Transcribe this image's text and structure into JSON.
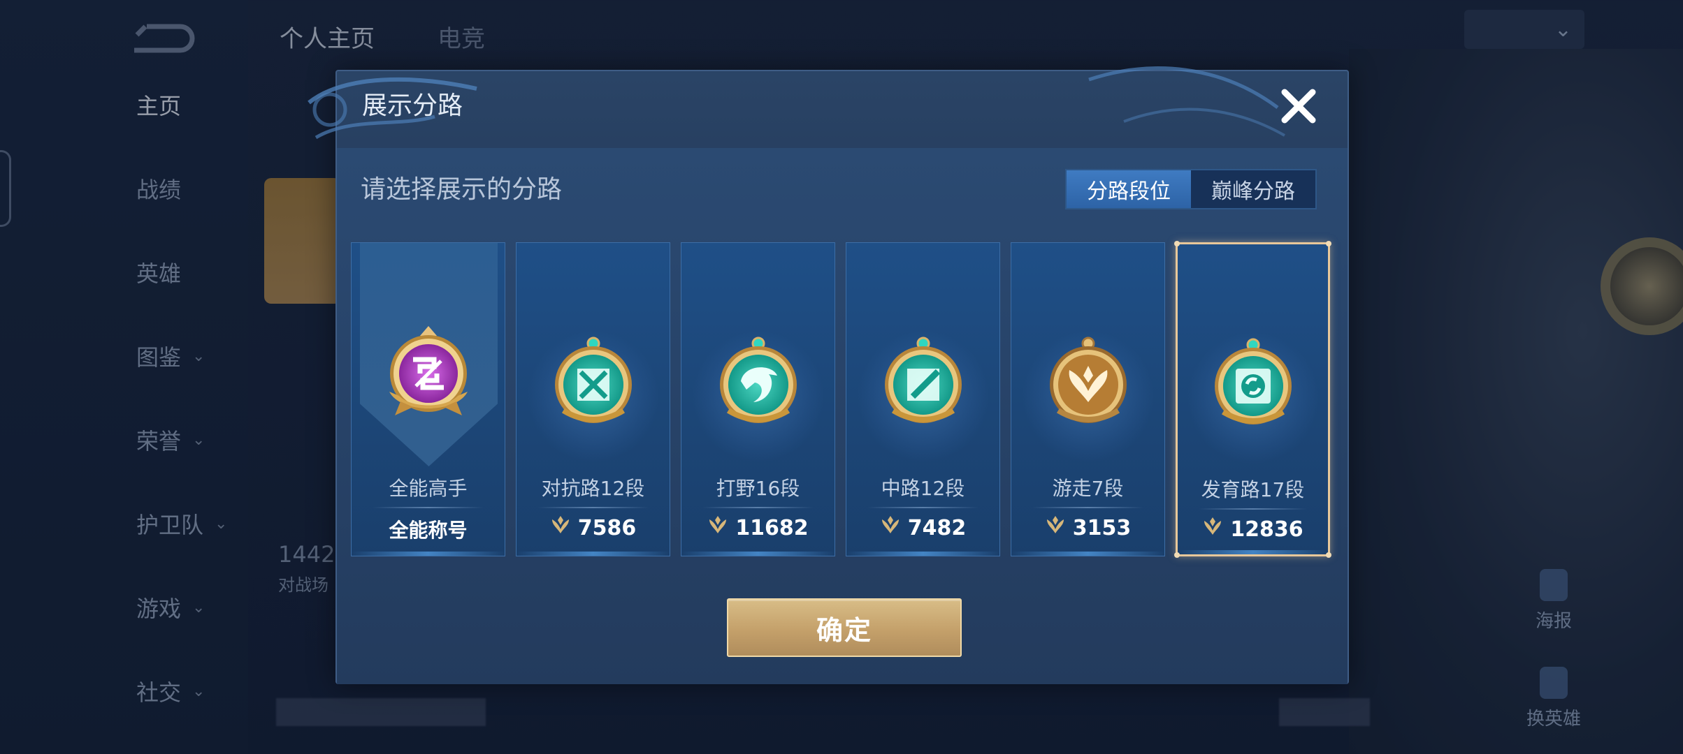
{
  "background": {
    "nav_items": [
      {
        "label": "主页",
        "has_chevron": false,
        "active": true
      },
      {
        "label": "战绩",
        "has_chevron": false,
        "active": false
      },
      {
        "label": "英雄",
        "has_chevron": false,
        "active": false
      },
      {
        "label": "图鉴",
        "has_chevron": true,
        "active": false
      },
      {
        "label": "荣誉",
        "has_chevron": true,
        "active": false
      },
      {
        "label": "护卫队",
        "has_chevron": true,
        "active": false
      },
      {
        "label": "游戏",
        "has_chevron": true,
        "active": false
      },
      {
        "label": "社交",
        "has_chevron": true,
        "active": false
      }
    ],
    "top_tabs": [
      "个人主页",
      "电竞"
    ],
    "dropdown_label": "",
    "stat_number": "1442",
    "stat_label": "对战场",
    "side_btn_poster": "海报",
    "side_btn_switch_hero": "换英雄"
  },
  "dialog": {
    "title": "展示分路",
    "subtitle": "请选择展示的分路",
    "tabs": [
      {
        "label": "分路段位",
        "active": true
      },
      {
        "label": "巅峰分路",
        "active": false
      }
    ],
    "cards": [
      {
        "name": "全能高手",
        "value": "全能称号",
        "emblem": "all-round-emblem-icon",
        "selected": false,
        "type": "banner"
      },
      {
        "name": "对抗路12段",
        "value": "7586",
        "emblem": "clash-lane-emblem-icon",
        "selected": false
      },
      {
        "name": "打野16段",
        "value": "11682",
        "emblem": "jungle-emblem-icon",
        "selected": false
      },
      {
        "name": "中路12段",
        "value": "7482",
        "emblem": "mid-lane-emblem-icon",
        "selected": false
      },
      {
        "name": "游走7段",
        "value": "3153",
        "emblem": "roam-emblem-icon",
        "selected": false
      },
      {
        "name": "发育路17段",
        "value": "12836",
        "emblem": "farm-lane-emblem-icon",
        "selected": true
      }
    ],
    "confirm_label": "确定"
  },
  "colors": {
    "accent_gold": "#d8bd87",
    "tab_active": "#3f7bc2",
    "emblem_teal": "#20c7b0",
    "emblem_purple": "#b33ad0",
    "emblem_gold": "#c9963a"
  }
}
